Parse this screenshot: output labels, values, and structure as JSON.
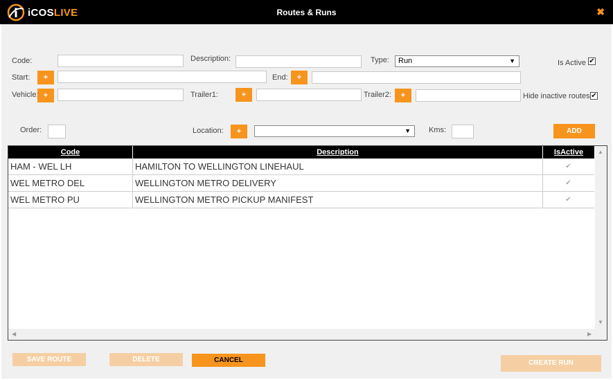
{
  "window": {
    "logo_prefix": "iCOS",
    "logo_suffix": "LIVE",
    "title": "Routes & Runs",
    "close_glyph": "✖"
  },
  "form": {
    "code_label": "Code:",
    "code_value": "",
    "description_label": "Description:",
    "description_value": "",
    "type_label": "Type:",
    "type_value": "Run",
    "is_active_label": "Is Active",
    "is_active_checked": true,
    "start_label": "Start:",
    "start_value": "",
    "end_label": "End:",
    "end_value": "",
    "vehicle_label": "Vehicle:",
    "vehicle_value": "",
    "trailer1_label": "Trailer1:",
    "trailer1_value": "",
    "trailer2_label": "Trailer2:",
    "trailer2_value": "",
    "hide_inactive_label": "Hide inactive routes",
    "hide_inactive_checked": true,
    "order_label": "Order:",
    "order_value": "",
    "location_label": "Location:",
    "location_value": "",
    "kms_label": "Kms:",
    "kms_value": "",
    "plus_glyph": "+",
    "add_label": "ADD"
  },
  "grid": {
    "columns": [
      "Code",
      "Description",
      "IsActive"
    ],
    "rows": [
      {
        "code": "HAM - WEL LH",
        "description": "HAMILTON TO WELLINGTON LINEHAUL",
        "is_active": true
      },
      {
        "code": "WEL METRO DEL",
        "description": "WELLINGTON METRO DELIVERY",
        "is_active": true
      },
      {
        "code": "WEL METRO PU",
        "description": "WELLINGTON METRO PICKUP MANIFEST",
        "is_active": true
      }
    ]
  },
  "footer": {
    "save_route": "SAVE ROUTE",
    "delete": "DELETE",
    "cancel": "CANCEL",
    "create_run": "CREATE RUN"
  },
  "colors": {
    "accent": "#f7941d",
    "accent_disabled": "#f5cfa3",
    "titlebar": "#000000",
    "panel": "#f0f0f0"
  },
  "icons": {
    "close": "close-icon",
    "dropdown": "chevron-down-icon",
    "checkbox": "check-icon",
    "logo": "icos-logo-icon"
  }
}
